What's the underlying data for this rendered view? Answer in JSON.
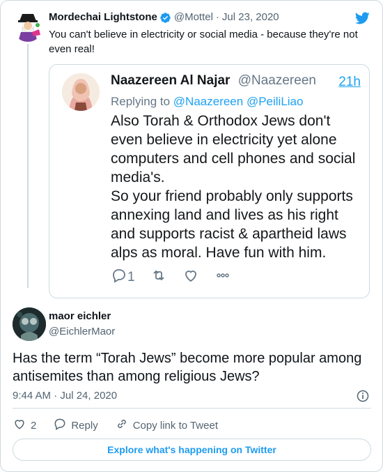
{
  "parent_tweet": {
    "author_name": "Mordechai Lightstone",
    "author_handle": "@Mottel",
    "separator": "·",
    "date": "Jul 23, 2020",
    "text": "You can't believe in electricity or social media - because they're not even real!",
    "verified_icon": "verified-badge-icon",
    "platform_icon": "twitter-bird-icon"
  },
  "embedded_screenshot": {
    "author_name": "Naazereen Al Najar",
    "author_handle": "@Naazereen",
    "time": "21h",
    "replying_to_label": "Replying to",
    "replying_to_handles": "@Naazereen @PeiliLiao",
    "text_lines": [
      "Also Torah & Orthodox Jews don't",
      "even believe in electricity yet alone",
      "computers and cell phones and social",
      "media's.",
      "So your friend probably only supports",
      "annexing land and lives as his right",
      "and supports racist & apartheid laws",
      "alps as moral. Have fun with him."
    ],
    "reply_count": "1",
    "action_icons": [
      "reply-icon",
      "retweet-icon",
      "like-icon",
      "more-icon"
    ]
  },
  "main_tweet": {
    "author_name": "maor eichler",
    "author_handle": "@EichlerMaor",
    "text": "Has the term “Torah Jews” become more popular among antisemites than among religious Jews?",
    "timestamp": "9:44 AM · Jul 24, 2020",
    "like_count": "2",
    "reply_label": "Reply",
    "copy_link_label": "Copy link to Tweet",
    "explore_label": "Explore what's happening on Twitter"
  },
  "colors": {
    "accent": "#1d9bf0",
    "text": "#0f1419",
    "muted": "#536471",
    "border": "#cfd9de"
  }
}
